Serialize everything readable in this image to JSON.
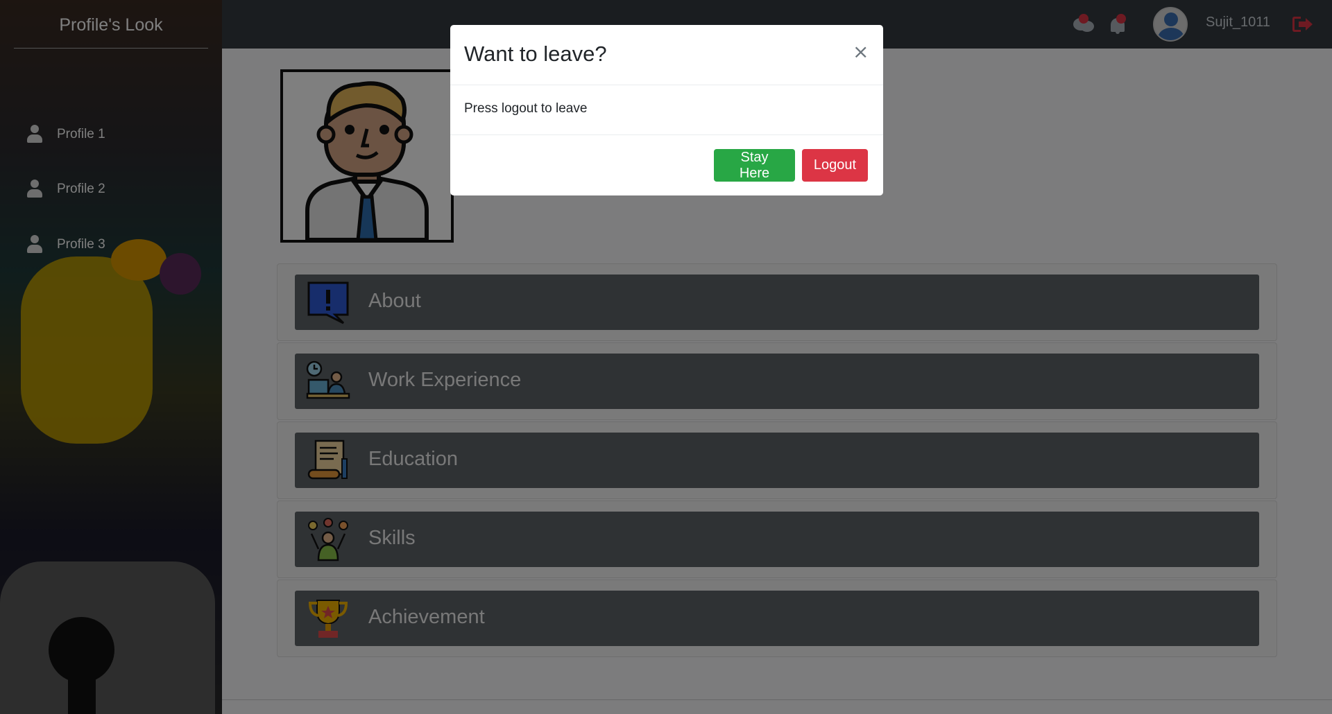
{
  "sidebar": {
    "title": "Profile's Look",
    "items": [
      {
        "label": "Profile 1"
      },
      {
        "label": "Profile 2"
      },
      {
        "label": "Profile 3"
      }
    ]
  },
  "header": {
    "username": "Sujit_1011",
    "icons": [
      "chat-icon",
      "bell-icon",
      "user-avatar",
      "logout-icon"
    ]
  },
  "main": {
    "sections": [
      {
        "label": "About",
        "icon": "info-speech-bubble-icon"
      },
      {
        "label": "Work Experience",
        "icon": "work-desk-icon"
      },
      {
        "label": "Education",
        "icon": "certificate-scroll-icon"
      },
      {
        "label": "Skills",
        "icon": "skills-person-icon"
      },
      {
        "label": "Achievement",
        "icon": "trophy-icon"
      }
    ]
  },
  "modal": {
    "title": "Want to leave?",
    "close_label": "×",
    "body": "Press logout to leave",
    "stay_label": "Stay Here",
    "logout_label": "Logout"
  },
  "colors": {
    "topbar": "#343a40",
    "card_bar": "#5f6469",
    "stay": "#28a745",
    "logout": "#dc3545"
  }
}
